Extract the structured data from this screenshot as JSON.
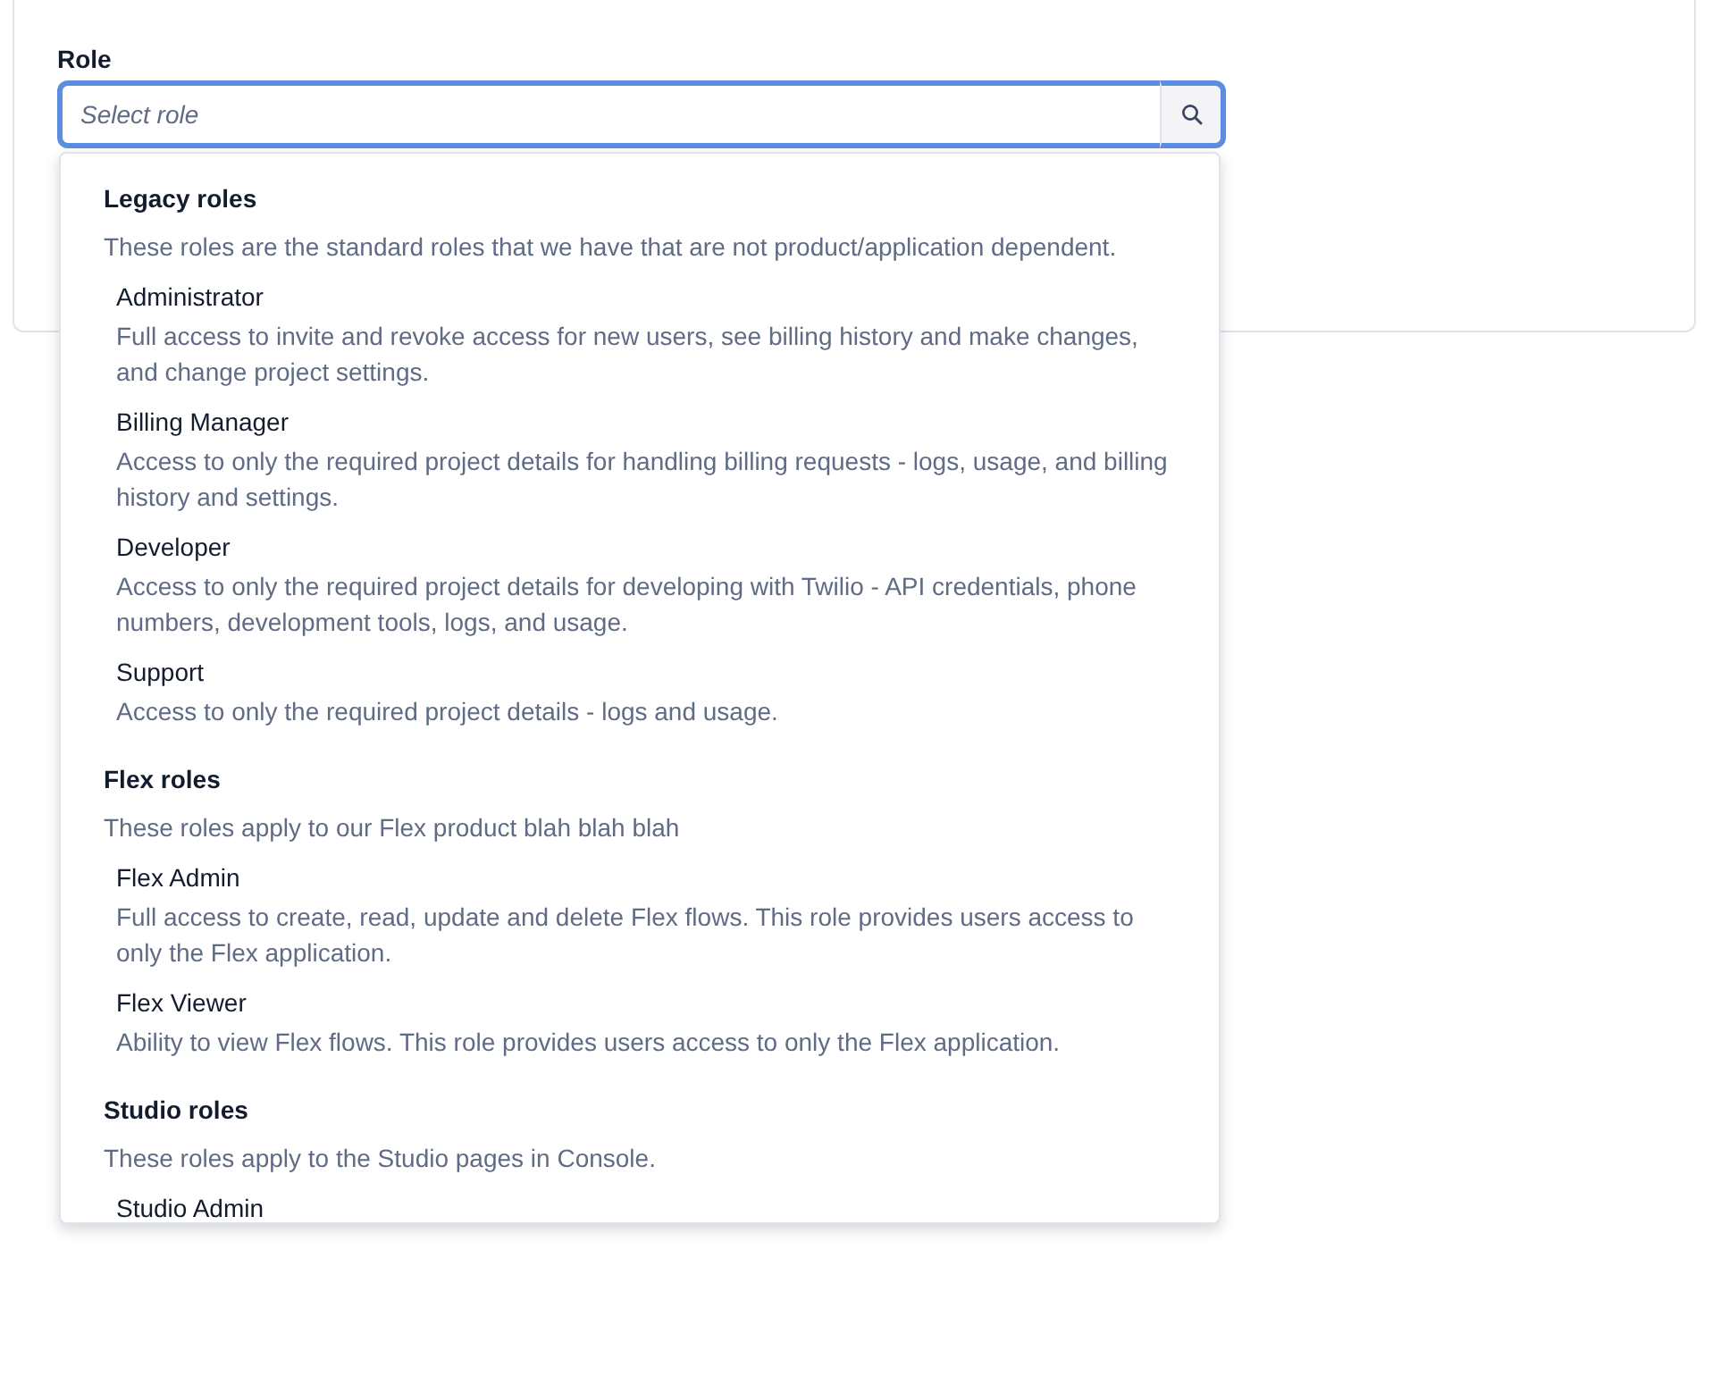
{
  "field": {
    "label": "Role",
    "placeholder": "Select role"
  },
  "groups": [
    {
      "title": "Legacy roles",
      "description": "These roles are the standard roles that we have that are not product/application dependent.",
      "options": [
        {
          "name": "Administrator",
          "description": "Full access to invite and revoke access for new users, see billing history and make changes, and change project settings."
        },
        {
          "name": "Billing Manager",
          "description": "Access to only the required project details for handling billing requests - logs, usage, and billing history and settings."
        },
        {
          "name": "Developer",
          "description": "Access to only the required project details for developing with Twilio - API credentials, phone numbers, development tools, logs, and usage."
        },
        {
          "name": "Support",
          "description": "Access to only the required project details - logs and usage."
        }
      ]
    },
    {
      "title": "Flex roles",
      "description": "These roles apply to our Flex product blah blah blah",
      "options": [
        {
          "name": "Flex Admin",
          "description": "Full access to create, read, update and delete Flex flows. This role provides users access to only the Flex application."
        },
        {
          "name": "Flex Viewer",
          "description": "Ability to view Flex flows. This role provides users access to only the Flex application."
        }
      ]
    },
    {
      "title": "Studio roles",
      "description": "These roles apply to the Studio pages in Console.",
      "options": [
        {
          "name": "Studio Admin"
        }
      ]
    }
  ]
}
